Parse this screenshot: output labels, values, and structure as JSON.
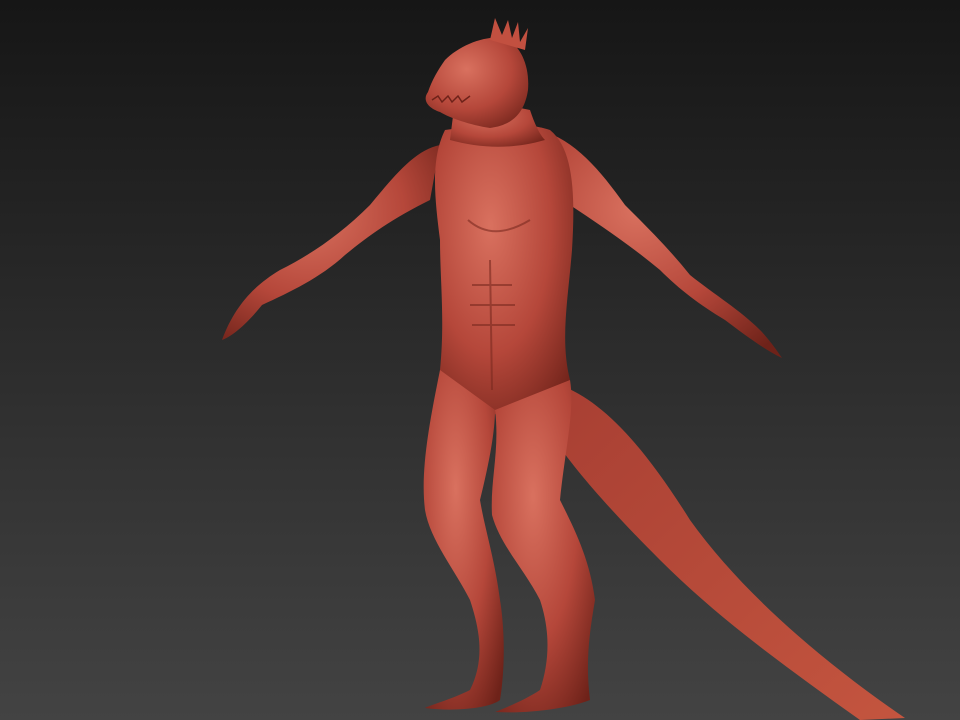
{
  "scene": {
    "subject": "lizard-creature-sculpt",
    "colors": {
      "background_top": "#161616",
      "background_bottom": "#434343",
      "skin_base": "#b5473a",
      "skin_light": "#d9715f",
      "skin_shadow": "#6e2219"
    }
  }
}
